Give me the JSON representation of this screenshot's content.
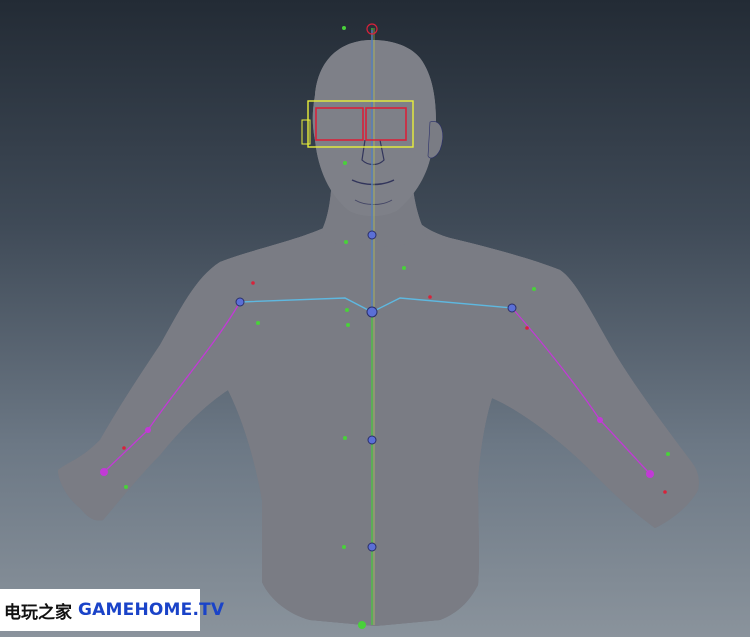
{
  "viewport": {
    "background_top": "#232b35",
    "background_bottom": "#8a939c",
    "mesh_fill": "#7a7c84",
    "wire_color": "#2a2f6a",
    "joint_color": "#5b6fd6",
    "spine_color": "#49d13a",
    "arm_joint_color": "#c23ad6",
    "selection_box_color": "#e8ef3a",
    "eye_box_color": "#d8223a"
  },
  "watermark": {
    "chinese": "电玩之家",
    "english": "GAMEHOME.TV",
    "text_color": "#1a43c8"
  }
}
